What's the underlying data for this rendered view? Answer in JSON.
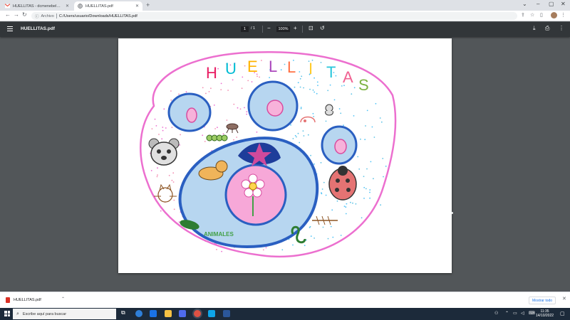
{
  "browser": {
    "tabs": [
      {
        "title": "HUELLITAS - dcmenebel@gmai",
        "favicon": "gmail-icon",
        "active": false
      },
      {
        "title": "HUELLITAS.pdf",
        "favicon": "globe-icon",
        "active": true
      }
    ],
    "address": {
      "label": "Archivo",
      "url": "C:/Users/usuario/Downloads/HUELLITAS.pdf"
    }
  },
  "pdf": {
    "title": "HUELLITAS.pdf",
    "page_current": "1",
    "page_total": "/ 1",
    "zoom": "100%"
  },
  "drawing": {
    "title_letters": [
      "H",
      "U",
      "E",
      "L",
      "L",
      "I",
      "T",
      "A",
      "S"
    ],
    "title_colors": [
      "#e91e63",
      "#00bcd4",
      "#ffb300",
      "#ab47bc",
      "#ff7043",
      "#ffca28",
      "#26c6da",
      "#f06292",
      "#7cb342"
    ],
    "animals_label": "ANIMALES",
    "colors": {
      "outer": "#ec6fcf",
      "paw": "#2a5fc1",
      "pad_fill": "#b7d6f0",
      "flower_pad": "#f7a8d8"
    }
  },
  "downloads": {
    "file": "HUELLITAS.pdf",
    "show_all": "Mostrar todo"
  },
  "taskbar": {
    "search_placeholder": "Escribe aquí para buscar",
    "time": "11:35",
    "date": "14/10/2022"
  }
}
